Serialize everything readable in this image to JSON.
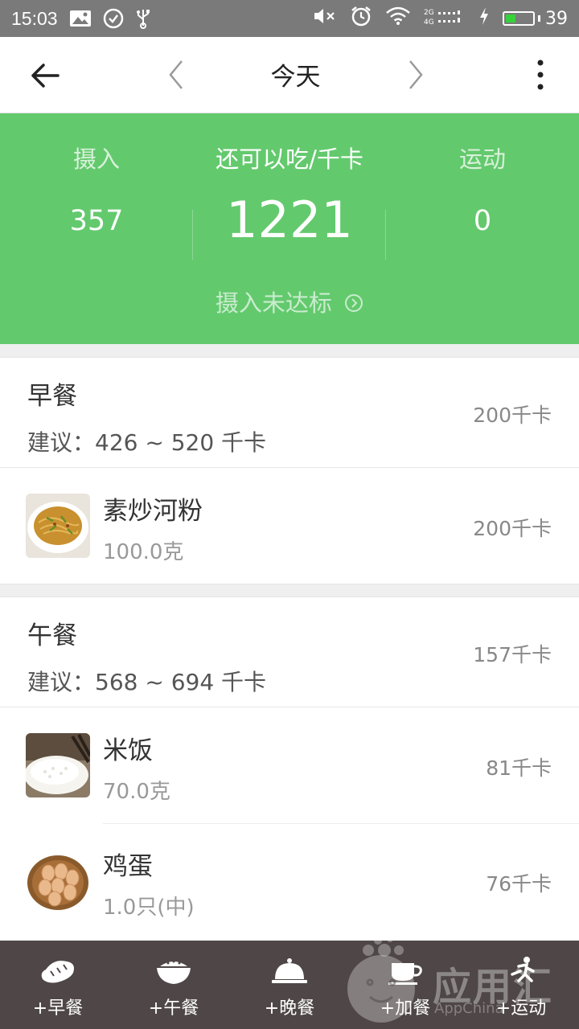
{
  "status_bar": {
    "time": "15:03",
    "battery": "39",
    "battery_level": 0.39
  },
  "nav": {
    "title": "今天"
  },
  "summary": {
    "intake_label": "摄入",
    "intake_value": "357",
    "remaining_label": "还可以吃/千卡",
    "remaining_value": "1221",
    "exercise_label": "运动",
    "exercise_value": "0",
    "status_link": "摄入未达标"
  },
  "meals": [
    {
      "name": "早餐",
      "suggestion": "建议：426 ~ 520 千卡",
      "kcal": "200千卡",
      "foods": [
        {
          "name": "素炒河粉",
          "qty": "100.0克",
          "kcal": "200千卡",
          "image": "stir-fried-noodles"
        }
      ]
    },
    {
      "name": "午餐",
      "suggestion": "建议：568 ~ 694 千卡",
      "kcal": "157千卡",
      "foods": [
        {
          "name": "米饭",
          "qty": "70.0克",
          "kcal": "81千卡",
          "image": "rice-bowl"
        },
        {
          "name": "鸡蛋",
          "qty": "1.0只(中)",
          "kcal": "76千卡",
          "image": "egg-basket"
        }
      ]
    }
  ],
  "bottom_tabs": [
    {
      "label": "+早餐",
      "icon": "bread-icon"
    },
    {
      "label": "+午餐",
      "icon": "rice-bowl-icon"
    },
    {
      "label": "+晚餐",
      "icon": "cloche-icon"
    },
    {
      "label": "+加餐",
      "icon": "cup-icon"
    },
    {
      "label": "+运动",
      "icon": "running-icon"
    }
  ],
  "watermark": {
    "text": "应用汇",
    "sub": "AppChina"
  },
  "colors": {
    "primary_green": "#63c96d",
    "bottom_bar": "#4f4747",
    "status_bar": "#7a7a7a"
  }
}
